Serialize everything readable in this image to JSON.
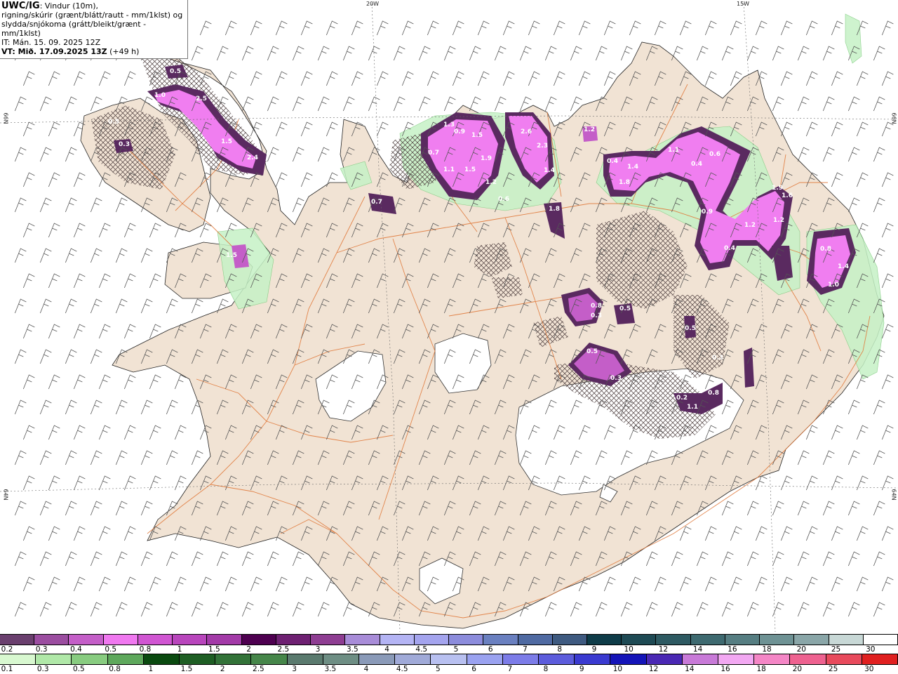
{
  "info_box": {
    "model": "UWC/IG",
    "line1": ": Vindur (10m),",
    "line2": "rigning/skúrir (grænt/blátt/rautt - mm/1klst) og",
    "line3": "slydda/snjókoma (grátt/bleikt/grænt - mm/1klst)",
    "initial_time": "IT: Mán. 15. 09. 2025 12Z",
    "valid_label": "VT: Mið. 17.09.2025 13Z",
    "lead_time": "(+49 h)"
  },
  "grid_labels": {
    "lon_20w": "20W",
    "lon_15w": "15W",
    "lat_66n_left": "66N",
    "lat_66n_right": "66N",
    "lat_64n_left": "64N",
    "lat_64n_right": "64N"
  },
  "map_colors": {
    "sea": "#ffffff",
    "land": "#f1e3d4",
    "glacier": "#ffffff",
    "roads": "#e07a3c",
    "snow_light": "#c6f2c6",
    "precip_dark": "#5a2a60",
    "precip_mid": "#b050b8",
    "precip_bright": "#f07ef0"
  },
  "precip_labels": [
    "0.5",
    "1.0",
    "2.5",
    "1.5",
    "2.4",
    "1.5",
    "0.3",
    "0.5",
    "0.7",
    "1.3",
    "0.9",
    "1.5",
    "0.7",
    "1.1",
    "1.5",
    "1.9",
    "1.2",
    "0.6",
    "2.6",
    "2.3",
    "1.4",
    "1.8",
    "1.2",
    "0.4",
    "1.8",
    "1.4",
    "1.1",
    "0.4",
    "0.6",
    "0.9",
    "1.2",
    "1.2",
    "0.4",
    "1.9",
    "1.6",
    "0.8",
    "1.4",
    "1.0",
    "0.8",
    "0.5",
    "0.3",
    "0.5",
    "0.3",
    "0.2",
    "1.1",
    "0.8",
    "0.5",
    "0.3"
  ],
  "legend_snow": {
    "labels": [
      "0.2",
      "0.3",
      "0.4",
      "0.5",
      "0.8",
      "1",
      "1.5",
      "2",
      "2.5",
      "3",
      "3.5",
      "4",
      "4.5",
      "5",
      "6",
      "7",
      "8",
      "9",
      "10",
      "12",
      "14",
      "16",
      "18",
      "20",
      "25",
      "30"
    ],
    "colors": [
      "#6a3f6e",
      "#9b4da0",
      "#c45ec8",
      "#f078f0",
      "#d055d2",
      "#b845bc",
      "#a33aa8",
      "#4e0050",
      "#6e2072",
      "#8e3d92",
      "#a88cd8",
      "#b4b4f4",
      "#a4a4ee",
      "#8c8cdc",
      "#6a80c0",
      "#4f6aa2",
      "#3e5a80",
      "#0e3c48",
      "#1e4a54",
      "#2e5a62",
      "#3e6a70",
      "#567e82",
      "#6e9294",
      "#8aa6a8",
      "#c8d8d6",
      "#ffffff"
    ]
  },
  "legend_rain": {
    "labels": [
      "0.1",
      "0.3",
      "0.5",
      "0.8",
      "1",
      "1.5",
      "2",
      "2.5",
      "3",
      "3.5",
      "4",
      "4.5",
      "5",
      "6",
      "7",
      "8",
      "9",
      "10",
      "12",
      "14",
      "16",
      "18",
      "20",
      "25",
      "30"
    ],
    "colors": [
      "#d8f8d0",
      "#b0e8a8",
      "#88cc80",
      "#5ea85c",
      "#0a4a10",
      "#1e5e24",
      "#327238",
      "#46864a",
      "#5a7a6e",
      "#6e8e84",
      "#8a9ab8",
      "#a0aad8",
      "#b8c0f0",
      "#9aa2f0",
      "#7c7ce8",
      "#5c5cdc",
      "#3a3ad0",
      "#1414b8",
      "#4a28b4",
      "#c87ad8",
      "#f2a8f2",
      "#f486c6",
      "#ee6290",
      "#e84a5c",
      "#e02020"
    ]
  }
}
